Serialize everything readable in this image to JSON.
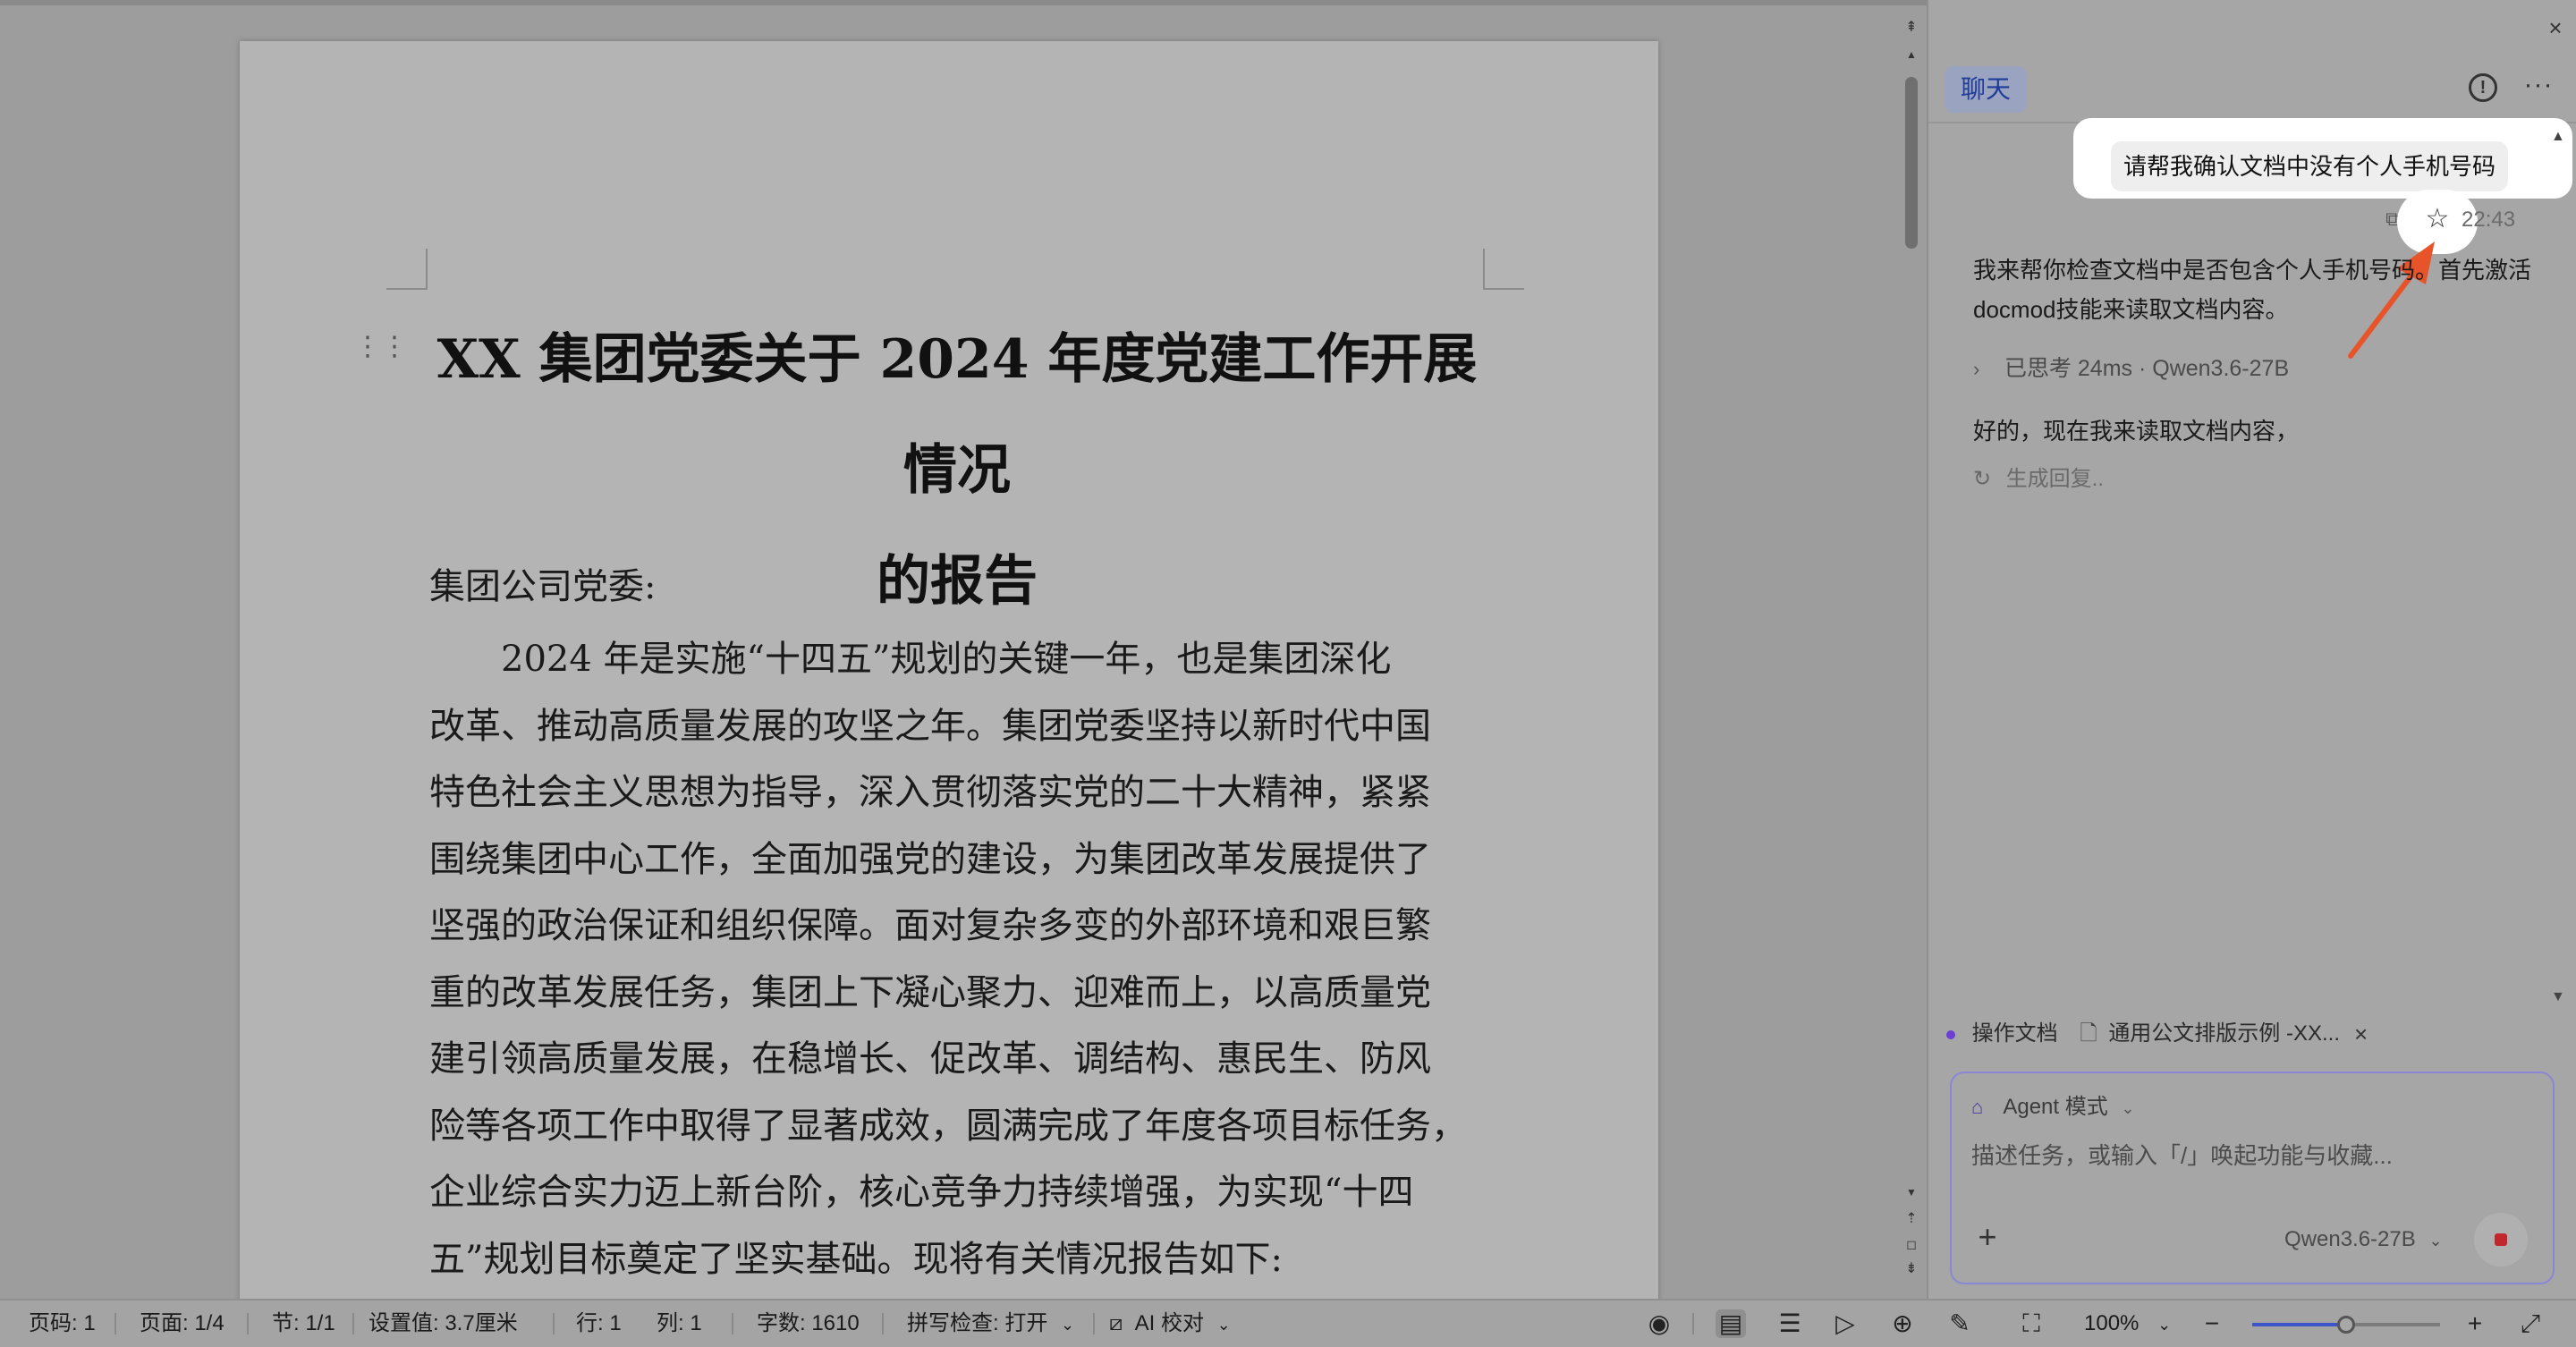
{
  "document": {
    "title_lines": [
      "XX 集团党委关于 2024 年度党建工作开展情况",
      "的报告"
    ],
    "salutation": "集团公司党委:",
    "body_lines": [
      "　　2024 年是实施“十四五”规划的关键一年，也是集团深化",
      "改革、推动高质量发展的攻坚之年。集团党委坚持以新时代中国",
      "特色社会主义思想为指导，深入贯彻落实党的二十大精神，紧紧",
      "围绕集团中心工作，全面加强党的建设，为集团改革发展提供了",
      "坚强的政治保证和组织保障。面对复杂多变的外部环境和艰巨繁",
      "重的改革发展任务，集团上下凝心聚力、迎难而上，以高质量党",
      "建引领高质量发展，在稳增长、促改革、调结构、惠民生、防风",
      "险等各项工作中取得了显著成效，圆满完成了年度各项目标任务，",
      "企业综合实力迈上新台阶，核心竞争力持续增强，为实现“十四",
      "五”规划目标奠定了坚实基础。现将有关情况报告如下:"
    ]
  },
  "panel": {
    "tab_chat": "聊天",
    "icons": {
      "close": "close-icon",
      "info": "info-icon",
      "more": "more-icon",
      "copy": "copy-icon",
      "star": "star-icon"
    },
    "user_message": "请帮我确认文档中没有个人手机号码",
    "message_time": "22:43",
    "ai_reply_1": "我来帮你检查文档中是否包含个人手机号码。首先激活docmod技能来读取文档内容。",
    "thought": "已思考 24ms · Qwen3.6-27B",
    "ai_reply_2": "好的，现在我来读取文档内容，",
    "generating": "生成回复..",
    "context_label": "操作文档",
    "context_doc": "通用公文排版示例 -XX...",
    "agent_mode": "Agent 模式",
    "input_placeholder": "描述任务，或输入「/」唤起功能与收藏...",
    "model": "Qwen3.6-27B",
    "accent_color": "#8b86d6",
    "stop_color": "#c2272d"
  },
  "statusbar": {
    "page_code": "页码: 1",
    "page": "页面: 1/4",
    "section": "节: 1/1",
    "setting": "设置值: 3.7厘米",
    "row": "行: 1",
    "col": "列: 1",
    "word_count": "字数: 1610",
    "spell_check": "拼写检查: 打开",
    "ai_proof": "AI 校对",
    "zoom": "100%",
    "zoom_level": 0.5
  }
}
